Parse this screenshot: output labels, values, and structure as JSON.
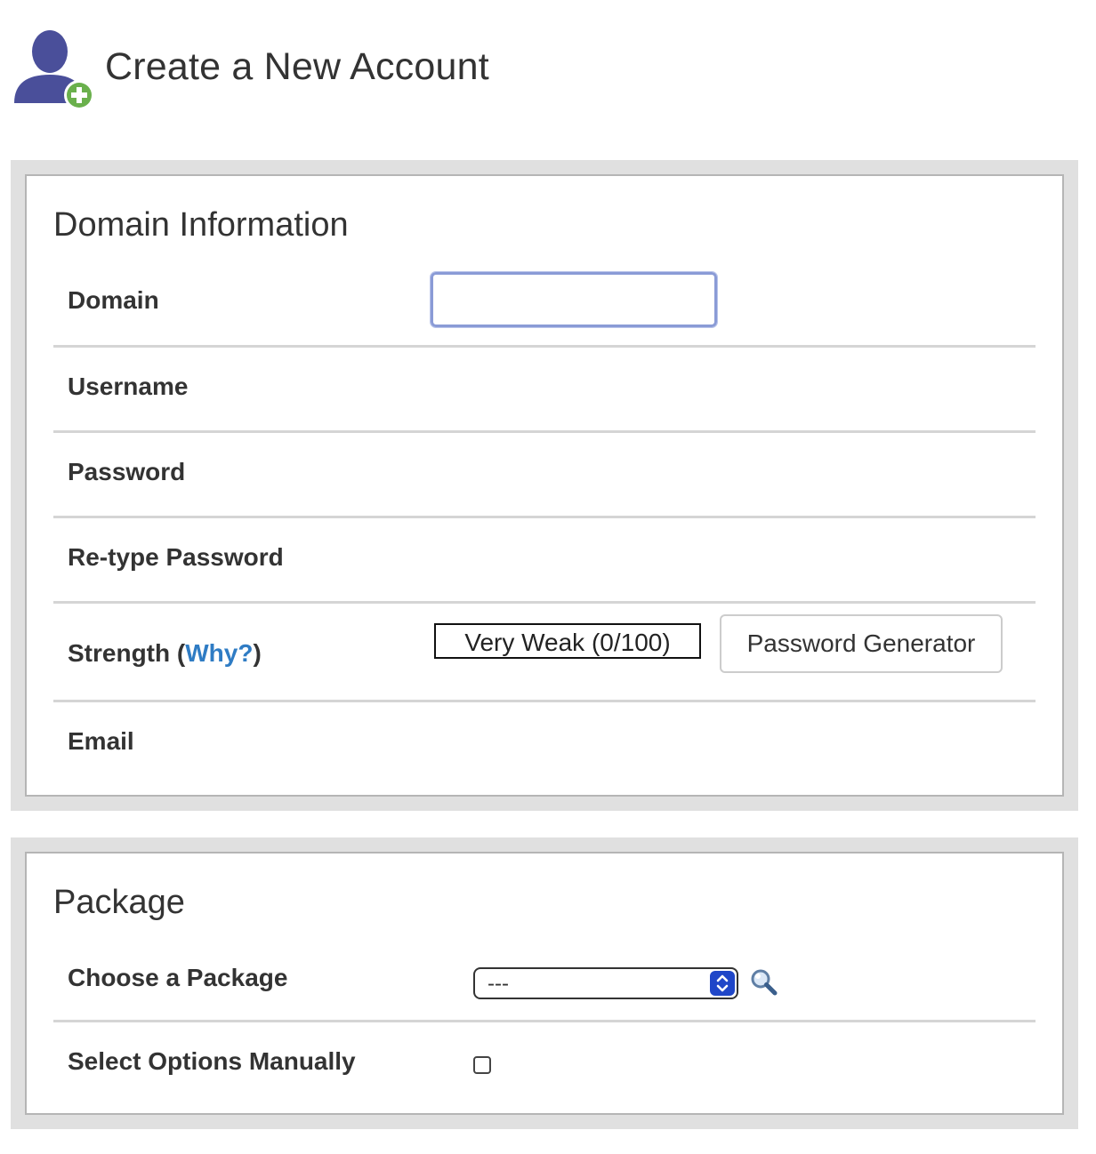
{
  "header": {
    "title": "Create a New Account",
    "icon": "add-user-icon"
  },
  "domain_section": {
    "title": "Domain Information",
    "fields": {
      "domain_label": "Domain",
      "domain_value": "",
      "username_label": "Username",
      "password_label": "Password",
      "retype_password_label": "Re-type Password",
      "strength_label_prefix": "Strength (",
      "strength_why_link": "Why?",
      "strength_label_suffix": ")",
      "strength_meter_text": "Very Weak (0/100)",
      "strength_value": 0,
      "password_generator_label": "Password Generator",
      "email_label": "Email"
    }
  },
  "package_section": {
    "title": "Package",
    "choose_package_label": "Choose a Package",
    "choose_package_selected": "---",
    "select_manually_label": "Select Options Manually",
    "select_manually_checked": false
  },
  "colors": {
    "link": "#2f7cc4",
    "panel_bg": "#e0e0e0",
    "icon_user": "#4a4f9a",
    "icon_plus": "#6ab04c",
    "select_accent": "#1f46c8"
  }
}
